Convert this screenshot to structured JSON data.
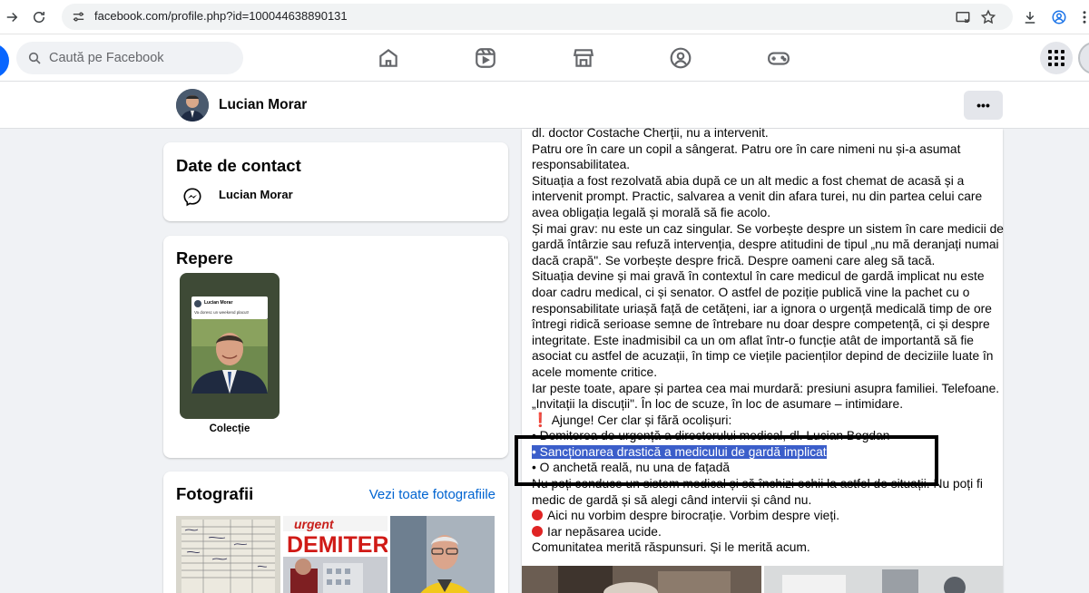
{
  "browser": {
    "url": "facebook.com/profile.php?id=100044638890131"
  },
  "nav": {
    "search_placeholder": "Caută pe Facebook"
  },
  "profile": {
    "name": "Lucian Morar",
    "more_label": "•••"
  },
  "contact": {
    "title": "Date de contact",
    "name": "Lucian Morar"
  },
  "highlights": {
    "title": "Repere",
    "story_author": "Lucian Morar",
    "story_text": "Va doresc un weekend placut!",
    "story_label": "Colecție"
  },
  "photos": {
    "title": "Fotografii",
    "link": "Vezi toate fotografiile",
    "tile2_text_top": "urgent",
    "tile2_text_big": "DEMITER"
  },
  "post": {
    "lines": [
      "dl. doctor Costache Cherții, nu a intervenit.",
      "Patru ore în care un copil a sângerat. Patru ore în care nimeni nu și-a asumat",
      "responsabilitatea.",
      "Situația a fost rezolvată abia după ce un alt medic a fost chemat de acasă și a",
      "intervenit prompt. Practic, salvarea a venit din afara turei, nu din partea celui care",
      "avea obligația legală și morală să fie acolo.",
      "Și mai grav: nu este un caz singular. Se vorbește despre un sistem în care medicii de",
      "gardă întârzie sau refuză intervenția, despre atitudini de tipul „nu mă deranjați numai",
      "dacă crapă\". Se vorbește despre frică. Despre oameni care aleg să tacă.",
      "Situația devine și mai gravă în contextul în care medicul de gardă implicat nu este",
      "doar cadru medical, ci și senator. O astfel de poziție publică vine la pachet cu o",
      "responsabilitate uriașă față de cetățeni, iar a ignora o urgență medicală timp de ore",
      "întregi ridică serioase semne de întrebare nu doar despre competență, ci și despre",
      "integritate. Este inadmisibil ca un om aflat într-o funcție atât de importantă să fie",
      "asociat cu astfel de acuzații, în timp ce viețile pacienților depind de deciziile luate în",
      "acele momente critice.",
      "Iar peste toate, apare și partea cea mai murdară: presiuni asupra familiei. Telefoane.",
      "„Invitații la discuții\". În loc de scuze, în loc de asumare – intimidare."
    ],
    "demand": "Ajunge! Cer clar și fără ocolișuri:",
    "bullet1": "• Demiterea de urgență a directorului medical, dl. Lucian Bogdan",
    "bullet2_highlighted": "• Sancționarea drastică a medicului de gardă implicat",
    "bullet3": "• O anchetă reală, nu una de fațadă",
    "after_lines": [
      "Nu poți conduce un sistem medical și să închizi ochii la astfel de situații. Nu poți fi",
      "medic de gardă și să alegi când intervii și când nu."
    ],
    "dot1": "Aici nu vorbim despre birocrație. Vorbim despre vieți.",
    "dot2": "Iar nepăsarea ucide.",
    "closing": "Comunitatea merită răspunsuri. Și le merită acum."
  },
  "colors": {
    "fb_blue": "#0866ff",
    "link": "#0064d1",
    "highlight": "#3b5eca",
    "annotation": "#000000"
  },
  "icons": [
    "arrow-right-icon",
    "reload-icon",
    "site-info-icon",
    "cast-icon",
    "star-icon",
    "download-icon",
    "profile-icon",
    "search-icon",
    "home-icon",
    "reels-icon",
    "marketplace-icon",
    "groups-icon",
    "gaming-icon",
    "menu-grid-icon",
    "messenger-icon",
    "more-icon"
  ]
}
